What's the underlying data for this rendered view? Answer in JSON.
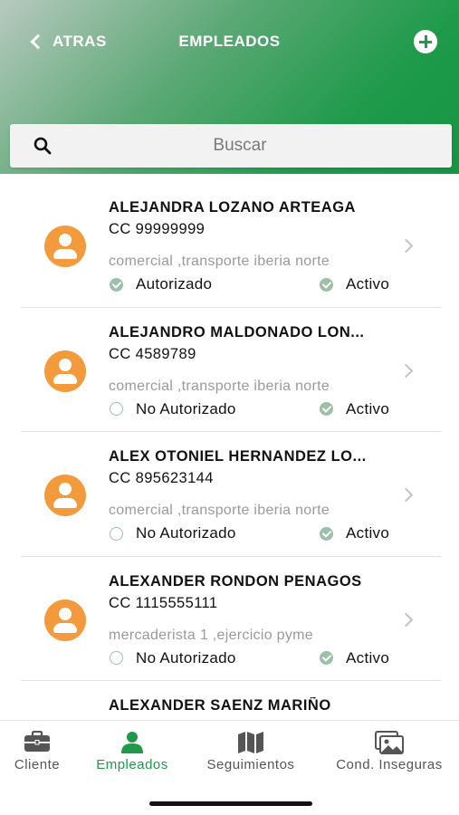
{
  "header": {
    "back_label": "ATRAS",
    "title": "EMPLEADOS",
    "gradient_colors": [
      "#b8c9bf",
      "#1e9a4a"
    ]
  },
  "search": {
    "placeholder": "Buscar",
    "value": ""
  },
  "employees": [
    {
      "name": "ALEJANDRA LOZANO ARTEAGA",
      "cc": "CC 99999999",
      "description": "comercial ,transporte iberia norte",
      "authorization": "Autorizado",
      "authorized": true,
      "state": "Activo"
    },
    {
      "name": "ALEJANDRO MALDONADO LON...",
      "cc": "CC 4589789",
      "description": "comercial ,transporte iberia norte",
      "authorization": "No Autorizado",
      "authorized": false,
      "state": "Activo"
    },
    {
      "name": "ALEX OTONIEL HERNANDEZ LO...",
      "cc": "CC 895623144",
      "description": "comercial ,transporte iberia norte",
      "authorization": "No Autorizado",
      "authorized": false,
      "state": "Activo"
    },
    {
      "name": "ALEXANDER RONDON PENAGOS",
      "cc": "CC 1115555111",
      "description": "mercaderista 1 ,ejercicio pyme",
      "authorization": "No Autorizado",
      "authorized": false,
      "state": "Activo"
    },
    {
      "name": "ALEXANDER SAENZ MARIÑO"
    }
  ],
  "tabbar": {
    "tabs": [
      {
        "label": "Cliente",
        "icon": "briefcase-icon",
        "active": false
      },
      {
        "label": "Empleados",
        "icon": "person-icon",
        "active": true
      },
      {
        "label": "Seguimientos",
        "icon": "map-icon",
        "active": false
      },
      {
        "label": "Cond. Inseguras",
        "icon": "gallery-icon",
        "active": false
      }
    ]
  },
  "colors": {
    "accent": "#1e9a4a",
    "avatar": "#f39a3c",
    "status_check": "#9bbfa7"
  }
}
